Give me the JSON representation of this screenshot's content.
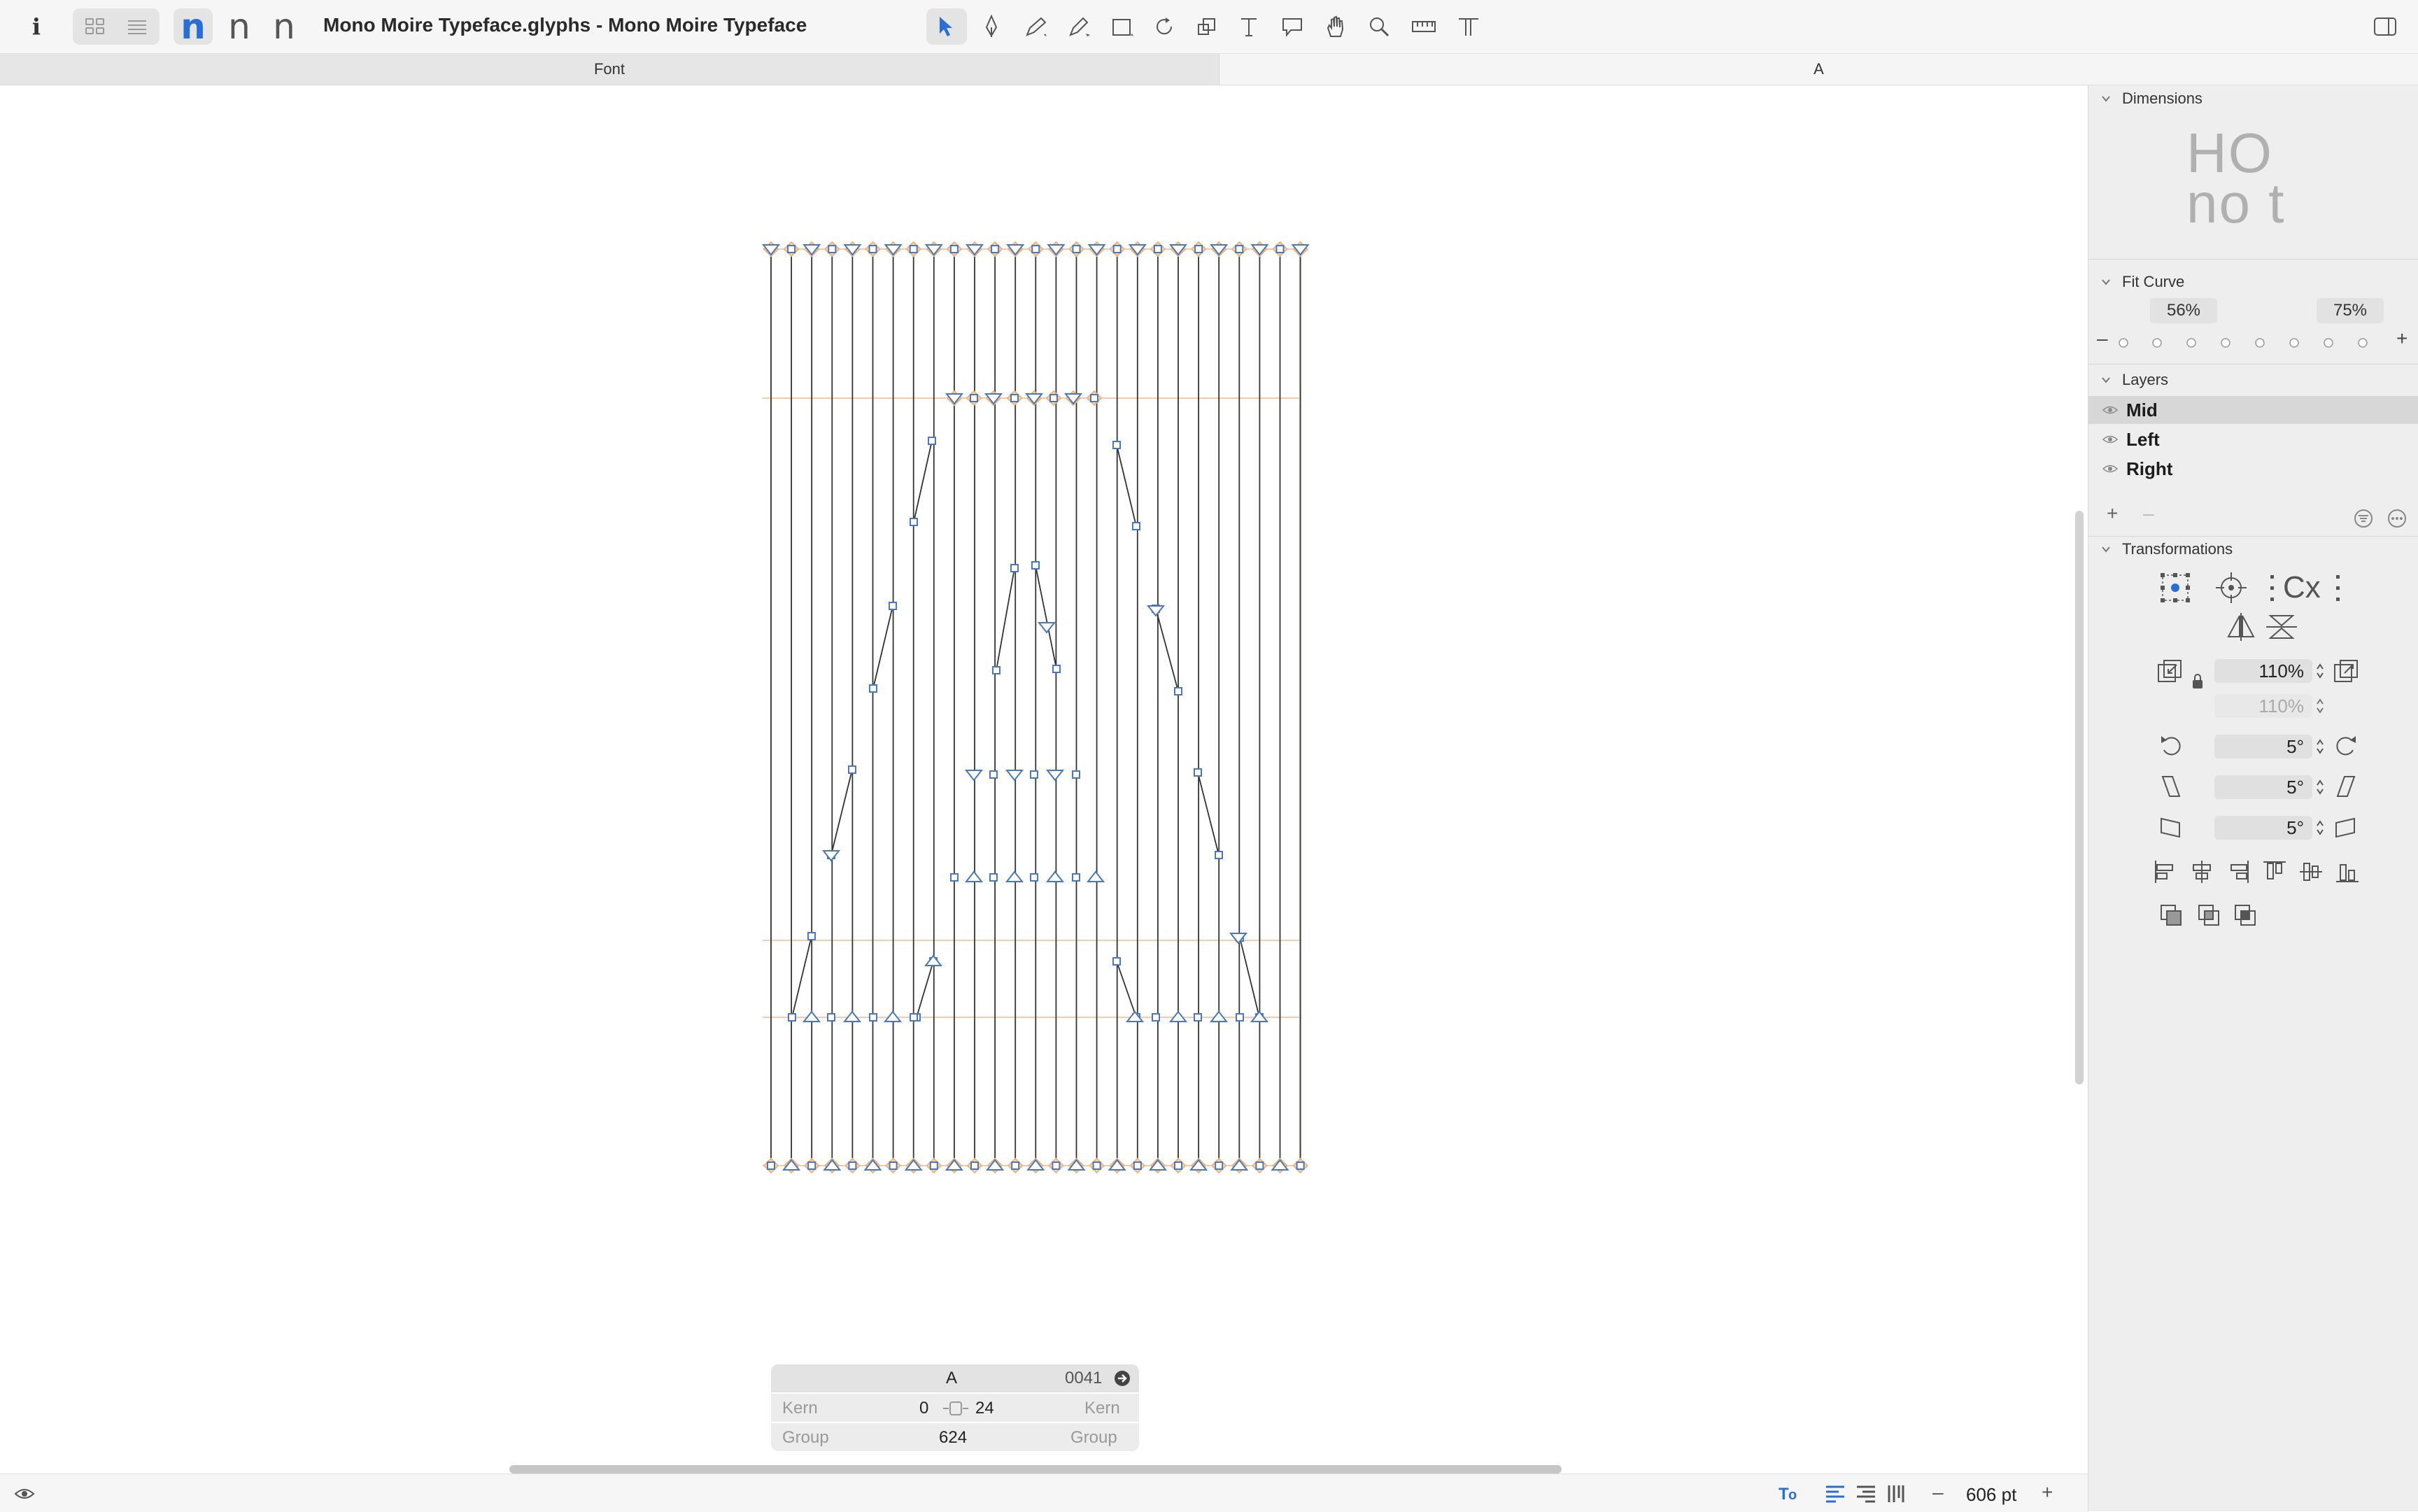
{
  "toolbar": {
    "info_icon": "info-icon",
    "view_grid_icon": "grid-view-icon",
    "view_list_icon": "list-view-icon",
    "glyph_n1": "n",
    "glyph_n2": "n",
    "glyph_n3": "n",
    "title": "Mono Moire Typeface.glyphs - Mono Moire Typeface",
    "tools": [
      "select-tool-icon",
      "draw-tool-icon",
      "pen-tool-icon",
      "pencil-tool-icon",
      "rectangle-tool-icon",
      "rotate-tool-icon",
      "scale-tool-icon",
      "text-tool-icon",
      "annotation-tool-icon",
      "hand-tool-icon",
      "zoom-tool-icon",
      "measure-tool-icon",
      "type-tool-icon"
    ],
    "sidebar_toggle_icon": "sidebar-toggle-icon"
  },
  "tabs": {
    "font": "Font",
    "glyph": "A"
  },
  "sidebar": {
    "dimensions": {
      "title": "Dimensions",
      "preview_line1": "HO",
      "preview_line2": "no t"
    },
    "fit_curve": {
      "title": "Fit Curve",
      "left_value": "56%",
      "right_value": "75%",
      "minus": "–",
      "plus": "+"
    },
    "layers": {
      "title": "Layers",
      "items": [
        {
          "name": "Mid",
          "selected": true
        },
        {
          "name": "Left",
          "selected": false
        },
        {
          "name": "Right",
          "selected": false
        }
      ],
      "add": "+",
      "remove": "–"
    },
    "transformations": {
      "title": "Transformations",
      "scale_value": "110%",
      "scale_value_disabled": "110%",
      "rotate_value": "5°",
      "slant_value": "5°",
      "skew_value": "5°"
    }
  },
  "info_box": {
    "glyph_name": "A",
    "unicode": "0041",
    "kern_label_left": "Kern",
    "kern_label_right": "Kern",
    "lsb": "0",
    "rsb": "24",
    "group_label_left": "Group",
    "group_label_right": "Group",
    "width": "624"
  },
  "status": {
    "zoom": "606 pt",
    "zoom_minus": "–",
    "zoom_plus": "+"
  },
  "colors": {
    "node_blue": "#4a78b8",
    "smooth_orange": "#f0b37a",
    "metrics_orange": "#f2c89a",
    "accent_blue": "#2a6fd6"
  }
}
